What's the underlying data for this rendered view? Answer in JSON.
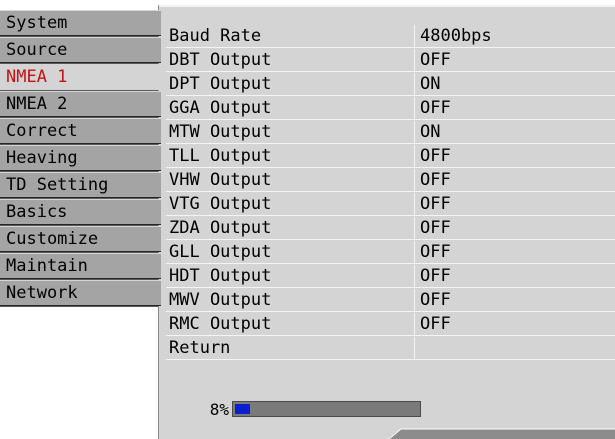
{
  "menu": {
    "items": [
      {
        "label": "System"
      },
      {
        "label": "Source"
      },
      {
        "label": "NMEA 1"
      },
      {
        "label": "NMEA 2"
      },
      {
        "label": "Correct"
      },
      {
        "label": "Heaving"
      },
      {
        "label": "TD Setting"
      },
      {
        "label": "Basics"
      },
      {
        "label": "Customize"
      },
      {
        "label": "Maintain"
      },
      {
        "label": "Network"
      }
    ],
    "active_index": 2,
    "active_color": "#c01414"
  },
  "settings": {
    "rows": [
      {
        "label": "Baud Rate",
        "value": "4800bps"
      },
      {
        "label": "DBT Output",
        "value": "OFF"
      },
      {
        "label": "DPT Output",
        "value": "ON"
      },
      {
        "label": "GGA Output",
        "value": "OFF"
      },
      {
        "label": "MTW Output",
        "value": "ON"
      },
      {
        "label": "TLL Output",
        "value": "OFF"
      },
      {
        "label": "VHW Output",
        "value": "OFF"
      },
      {
        "label": "VTG Output",
        "value": "OFF"
      },
      {
        "label": "ZDA Output",
        "value": "OFF"
      },
      {
        "label": "GLL Output",
        "value": "OFF"
      },
      {
        "label": "HDT Output",
        "value": "OFF"
      },
      {
        "label": "MWV Output",
        "value": "OFF"
      },
      {
        "label": "RMC Output",
        "value": "OFF"
      },
      {
        "label": "Return",
        "value": ""
      }
    ]
  },
  "progress": {
    "text": "8%",
    "fraction": 0.08,
    "fill_color": "#0a1fd0"
  }
}
